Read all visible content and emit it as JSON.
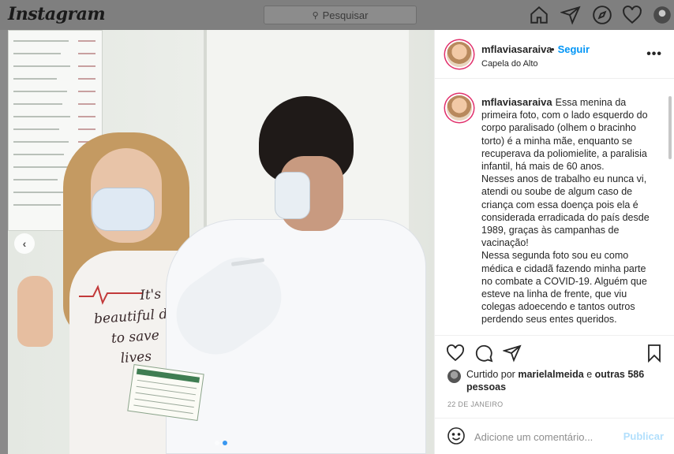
{
  "topbar": {
    "logo": "Instagram",
    "search_placeholder": "Pesquisar",
    "icons": [
      "home-icon",
      "send-icon",
      "explore-icon",
      "heart-icon",
      "profile-avatar"
    ]
  },
  "post": {
    "username": "mflaviasaraiva",
    "follow_label": "Seguir",
    "bullet": "•",
    "location": "Capela do Alto",
    "more": "•••",
    "shirt_text": [
      "It's",
      "beautiful d",
      "to save",
      "lives"
    ],
    "carousel": {
      "current": 2,
      "total": 2
    },
    "caption": {
      "username": "mflaviasaraiva",
      "lines": [
        "Essa menina da primeira foto, com o lado esquerdo do corpo paralisado (olhem o bracinho torto) é a minha mãe, enquanto se recuperava da poliomielite, a paralisia infantil, há mais de 60 anos.",
        "Nesses anos de trabalho eu nunca vi, atendi ou soube de algum caso de criança com essa doença pois ela é considerada erradicada do país desde 1989, graças às campanhas de vacinação!",
        "Nessa segunda foto sou eu como médica e cidadã fazendo minha parte no combate a COVID-19. Alguém que esteve na linha de frente, que viu colegas adoecendo e tantos outros perdendo seus entes queridos."
      ]
    },
    "likes": {
      "prefix": "Curtido por",
      "user": "marielalmeida",
      "and": "e",
      "others": "outras 586 pessoas"
    },
    "date": "22 DE JANEIRO",
    "comment": {
      "placeholder": "Adicione um comentário...",
      "value": "",
      "publish_label": "Publicar"
    }
  },
  "colors": {
    "accent": "#0095f6",
    "publish_disabled": "#b2dffc",
    "story_ring": "#e1306c",
    "carousel_active": "#3897f0"
  }
}
